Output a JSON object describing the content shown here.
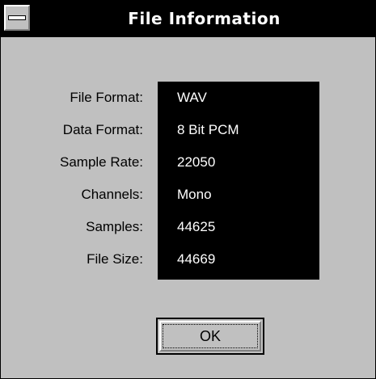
{
  "window": {
    "title": "File Information"
  },
  "info": {
    "rows": [
      {
        "label": "File Format:",
        "value": "WAV"
      },
      {
        "label": "Data Format:",
        "value": "8 Bit PCM"
      },
      {
        "label": "Sample Rate:",
        "value": "22050"
      },
      {
        "label": "Channels:",
        "value": "Mono"
      },
      {
        "label": "Samples:",
        "value": "44625"
      },
      {
        "label": "File Size:",
        "value": "44669"
      }
    ]
  },
  "buttons": {
    "ok_label": "OK"
  },
  "icons": {
    "system_menu": "system-menu-icon"
  },
  "colors": {
    "titlebar": "#000000",
    "background": "#c0c0c0",
    "value_box": "#000000",
    "value_text": "#ffffff"
  }
}
